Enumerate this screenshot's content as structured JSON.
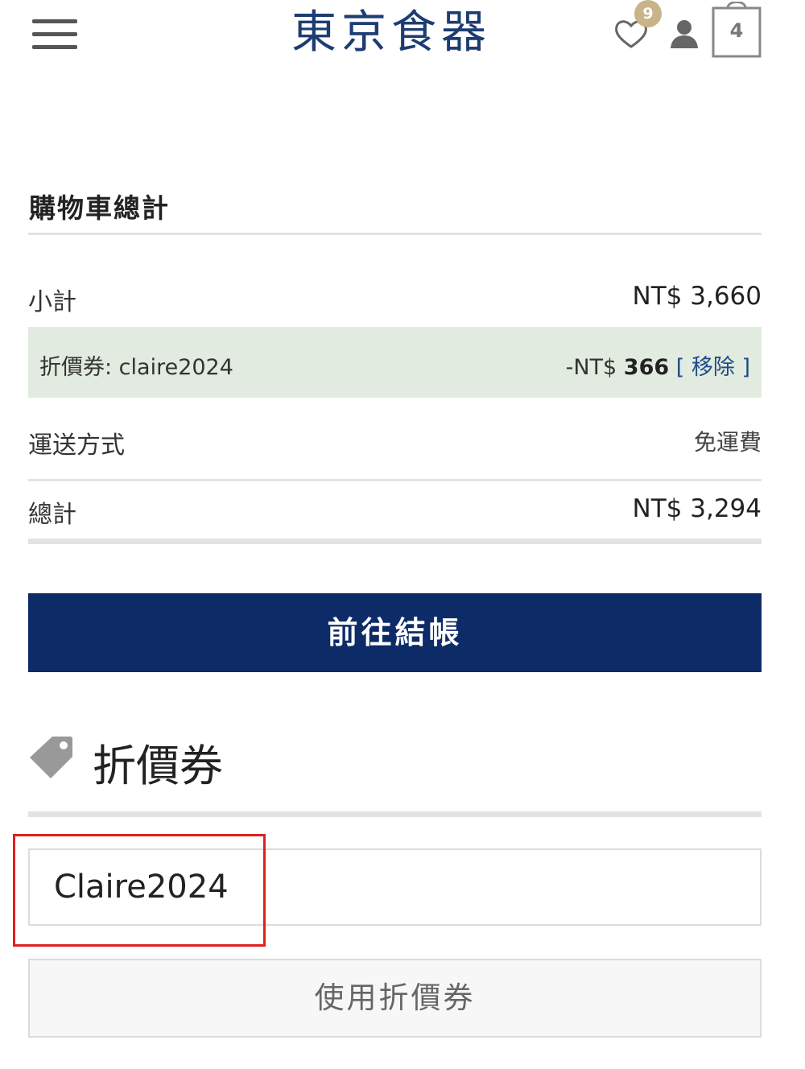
{
  "header": {
    "logo": "東京食器",
    "wishlist_count": "9",
    "cart_count": "4",
    "brand_color": "#1d3c73",
    "badge_color": "#c9b48a"
  },
  "totals": {
    "title": "購物車總計",
    "subtotal_label": "小計",
    "subtotal_value": "NT$ 3,660",
    "coupon_label": "折價券: claire2024",
    "coupon_amount_prefix": "-NT$ ",
    "coupon_amount": "366",
    "coupon_remove": "[ 移除 ]",
    "shipping_label": "運送方式",
    "shipping_value": "免運費",
    "total_label": "總計",
    "total_value": "NT$ 3,294",
    "coupon_row_color": "#e2ebdf"
  },
  "checkout": {
    "button_label": "前往結帳",
    "button_color": "#0d2b67"
  },
  "coupon": {
    "heading": "折價券",
    "input_value": "Claire2024",
    "apply_label": "使用折價券"
  },
  "icons": [
    "menu-icon",
    "heart-icon",
    "user-icon",
    "shopping-bag-icon",
    "tag-icon"
  ]
}
